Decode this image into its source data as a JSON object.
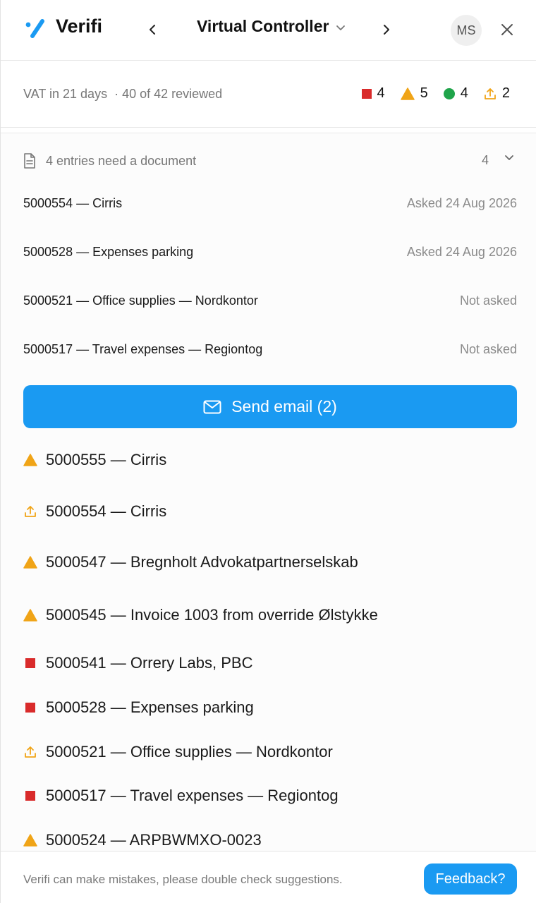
{
  "colors": {
    "accent": "#1a9af2",
    "red": "#d92b2b",
    "orange": "#f0a417",
    "green": "#1fa44a"
  },
  "header": {
    "brand": "Verifi",
    "title": "Virtual Controller",
    "avatar_initials": "MS",
    "icons": [
      "verifi-logo-icon",
      "chevron-left-icon",
      "chevron-down-icon",
      "chevron-right-icon",
      "close-icon"
    ]
  },
  "status": {
    "vat_text": "VAT in 21 days",
    "reviewed_text": "· 40 of 42 reviewed",
    "counts": {
      "red": "4",
      "warning": "5",
      "ok": "4",
      "upload": "2"
    }
  },
  "documents": {
    "header_label": "4 entries need a document",
    "header_count": "4",
    "items": [
      {
        "entry": "5000554 — Cirris",
        "state": "Asked 24 Aug 2026"
      },
      {
        "entry": "5000528 — Expenses parking",
        "state": "Asked 24 Aug 2026"
      },
      {
        "entry": "5000521 — Office supplies — Nordkontor",
        "state": "Not asked"
      },
      {
        "entry": "5000517 — Travel expenses — Regiontog",
        "state": "Not asked"
      }
    ],
    "send_button": "Send email (2)"
  },
  "issues": [
    {
      "icon": "warning-icon",
      "text": "5000555 — Cirris"
    },
    {
      "icon": "upload-icon",
      "text": "5000554 — Cirris"
    },
    {
      "icon": "warning-icon",
      "text": "5000547 — Bregnholt Advokatpartnerselskab"
    },
    {
      "icon": "warning-icon",
      "text": "5000545 — Invoice 1003 from override Ølstykke"
    },
    {
      "icon": "error-square-icon",
      "text": "5000541 — Orrery Labs, PBC"
    },
    {
      "icon": "error-square-icon",
      "text": "5000528 — Expenses parking"
    },
    {
      "icon": "upload-icon",
      "text": "5000521 — Office supplies — Nordkontor"
    },
    {
      "icon": "error-square-icon",
      "text": "5000517 — Travel expenses — Regiontog"
    },
    {
      "icon": "warning-icon",
      "text": "5000524 — ARPBWMXO-0023"
    }
  ],
  "footer": {
    "disclaimer": "Verifi can make mistakes, please double check suggestions.",
    "feedback_button": "Feedback?"
  }
}
